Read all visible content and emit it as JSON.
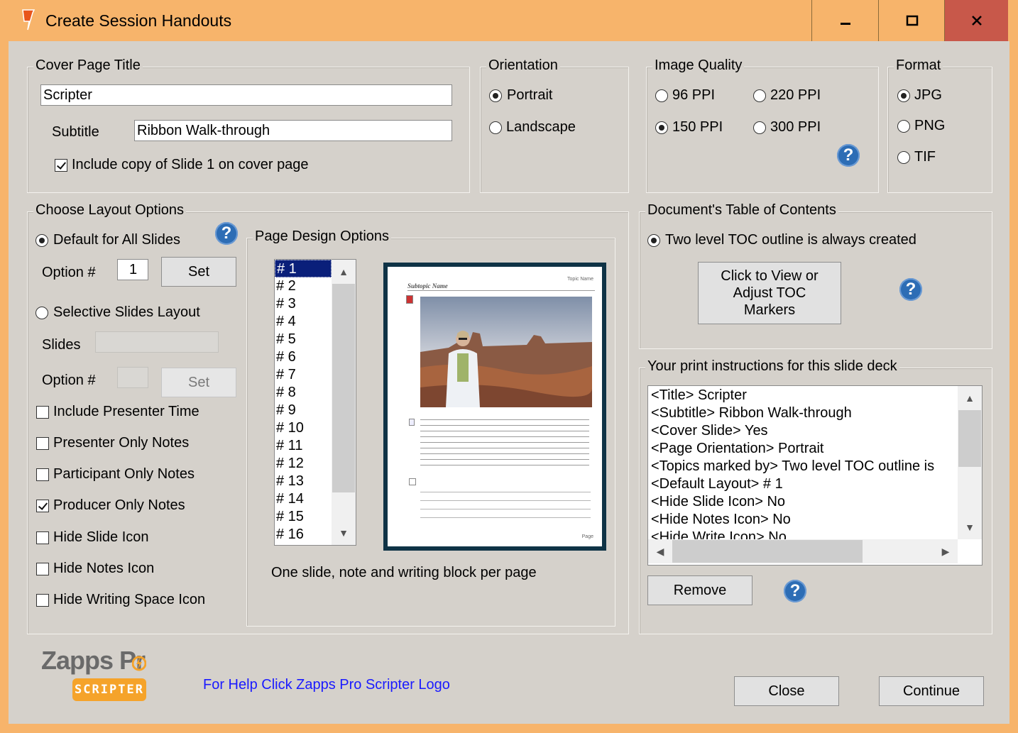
{
  "window": {
    "title": "Create Session Handouts",
    "controls": [
      "minimize",
      "maximize",
      "close"
    ]
  },
  "cover": {
    "legend": "Cover Page Title",
    "title_value": "Scripter",
    "subtitle_label": "Subtitle",
    "subtitle_value": "Ribbon Walk-through",
    "include_slide1_label": "Include copy of Slide 1 on cover page",
    "include_slide1_checked": true
  },
  "orientation": {
    "legend": "Orientation",
    "options": [
      {
        "label": "Portrait",
        "selected": true
      },
      {
        "label": "Landscape",
        "selected": false
      }
    ]
  },
  "image_quality": {
    "legend": "Image Quality",
    "options": [
      {
        "label": "96 PPI",
        "selected": false
      },
      {
        "label": "220 PPI",
        "selected": false
      },
      {
        "label": "150 PPI",
        "selected": true
      },
      {
        "label": "300 PPI",
        "selected": false
      }
    ],
    "help": "?"
  },
  "format": {
    "legend": "Format",
    "options": [
      {
        "label": "JPG",
        "selected": true
      },
      {
        "label": "PNG",
        "selected": false
      },
      {
        "label": "TIF",
        "selected": false
      }
    ]
  },
  "layout": {
    "legend": "Choose Layout Options",
    "default_label": "Default for All Slides",
    "default_selected": true,
    "option_label": "Option #",
    "option_value": "1",
    "set_label": "Set",
    "selective_label": "Selective Slides Layout",
    "selective_selected": false,
    "slides_label": "Slides",
    "option2_label": "Option #",
    "set2_label": "Set",
    "checkboxes": [
      {
        "label": "Include Presenter Time",
        "checked": false
      },
      {
        "label": "Presenter Only Notes",
        "checked": false
      },
      {
        "label": "Participant Only Notes",
        "checked": false
      },
      {
        "label": "Producer Only Notes",
        "checked": true
      },
      {
        "label": "Hide Slide Icon",
        "checked": false
      },
      {
        "label": "Hide Notes Icon",
        "checked": false
      },
      {
        "label": "Hide Writing Space Icon",
        "checked": false
      }
    ],
    "help": "?"
  },
  "page_design": {
    "legend": "Page Design Options",
    "items": [
      "# 1",
      "# 2",
      "# 3",
      "# 4",
      "# 5",
      "# 6",
      "# 7",
      "# 8",
      "# 9",
      "# 10",
      "# 11",
      "# 12",
      "# 13",
      "# 14",
      "# 15",
      "# 16"
    ],
    "selected_index": 0,
    "preview_subtopic": "Subtopic Name",
    "preview_topic": "Topic Name",
    "preview_page": "Page",
    "description": "One slide, note and writing block per page"
  },
  "toc": {
    "legend": "Document's Table of Contents",
    "radio_label": "Two level TOC outline is always created",
    "radio_selected": true,
    "button_lines": [
      "Click to View or",
      "Adjust TOC",
      "Markers"
    ],
    "help": "?"
  },
  "instructions": {
    "legend": "Your print instructions for this slide deck",
    "lines": [
      "<Title> Scripter",
      "<Subtitle> Ribbon Walk-through",
      "<Cover Slide> Yes",
      "<Page Orientation> Portrait",
      "<Topics marked by> Two level TOC outline is",
      "<Default Layout> # 1",
      "<Hide Slide Icon> No",
      "<Hide Notes Icon> No",
      "<Hide Write Icon> No"
    ],
    "remove_label": "Remove",
    "help": "?"
  },
  "footer": {
    "logo_text": "Zapps Pr",
    "logo_badge": "SCRIPTER",
    "help_link": "For Help Click Zapps Pro Scripter Logo",
    "close_label": "Close",
    "continue_label": "Continue"
  },
  "colors": {
    "titlebar": "#f7b46b",
    "client": "#d5d1cb",
    "close_button": "#c8584a",
    "link": "#1a1aff",
    "selection": "#0a1f7a",
    "logo_orange": "#f5a32a"
  }
}
